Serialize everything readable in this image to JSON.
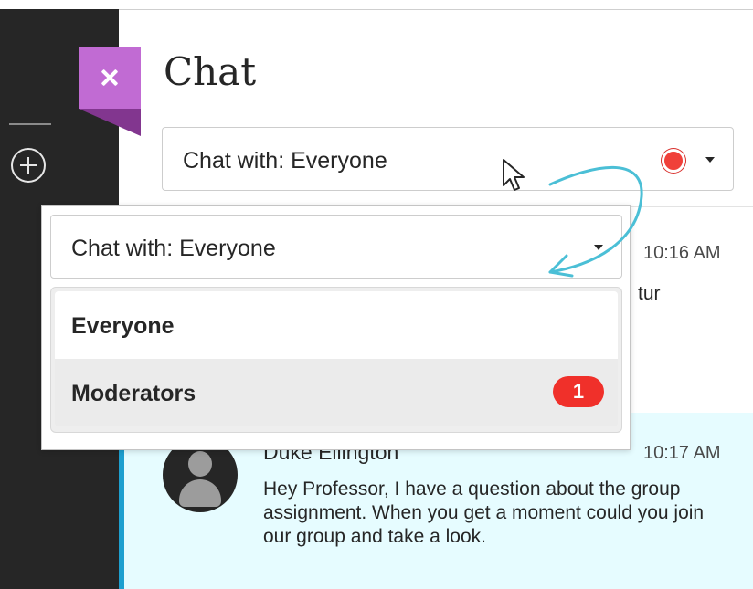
{
  "panel": {
    "title": "Chat",
    "close_label": "×"
  },
  "chat_select": {
    "label": "Chat with: Everyone",
    "status_color": "#f0403a"
  },
  "dropdown": {
    "label": "Chat with: Everyone",
    "options": [
      {
        "label": "Everyone"
      },
      {
        "label": "Moderators",
        "badge": "1"
      }
    ]
  },
  "messages": [
    {
      "time": "10:16 AM",
      "text_fragment": "tur"
    },
    {
      "author": "Duke Ellington",
      "time": "10:17 AM",
      "text": "Hey Professor, I have a question about the group assignment. When you get a moment could you join our group and take a look."
    }
  ],
  "colors": {
    "accent_purple": "#c16bd3",
    "badge_red": "#f0302a",
    "highlight_bg": "#e6fcff",
    "highlight_border": "#1e9fcf",
    "arrow_teal": "#4bbfd6"
  }
}
